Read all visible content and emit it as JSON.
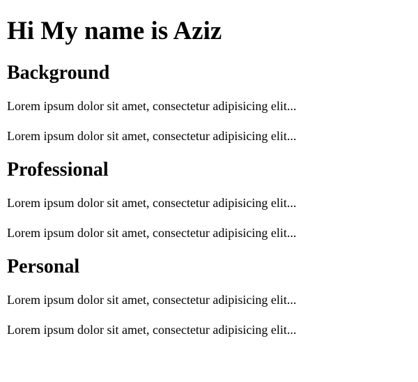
{
  "page": {
    "title": "Hi My name is Aziz",
    "sections": [
      {
        "heading": "Background",
        "paragraphs": [
          "Lorem ipsum dolor sit amet, consectetur adipisicing elit...",
          "Lorem ipsum dolor sit amet, consectetur adipisicing elit..."
        ]
      },
      {
        "heading": "Professional",
        "paragraphs": [
          "Lorem ipsum dolor sit amet, consectetur adipisicing elit...",
          "Lorem ipsum dolor sit amet, consectetur adipisicing elit..."
        ]
      },
      {
        "heading": "Personal",
        "paragraphs": [
          "Lorem ipsum dolor sit amet, consectetur adipisicing elit...",
          "Lorem ipsum dolor sit amet, consectetur adipisicing elit..."
        ]
      }
    ]
  }
}
